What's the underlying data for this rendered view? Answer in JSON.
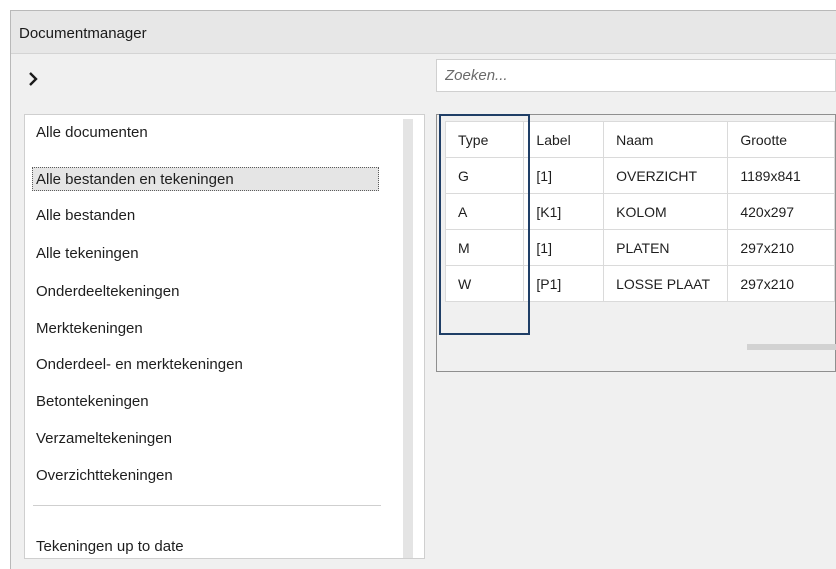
{
  "window": {
    "title": "Documentmanager"
  },
  "search": {
    "placeholder": "Zoeken..."
  },
  "filters": {
    "items": [
      "Alle documenten",
      "Alle bestanden en tekeningen",
      "Alle bestanden",
      "Alle tekeningen",
      "Onderdeeltekeningen",
      "Merktekeningen",
      "Onderdeel- en merktekeningen",
      "Betontekeningen",
      "Verzameltekeningen",
      "Overzichttekeningen"
    ],
    "selected": "Alle bestanden en tekeningen",
    "bottom_item": "Tekeningen up to date"
  },
  "table": {
    "headers": {
      "type": "Type",
      "label": "Label",
      "naam": "Naam",
      "grootte": "Grootte"
    },
    "rows": [
      {
        "type": "G",
        "label": "[1]",
        "naam": "OVERZICHT",
        "grootte": "1189x841"
      },
      {
        "type": "A",
        "label": "[K1]",
        "naam": "KOLOM",
        "grootte": "420x297"
      },
      {
        "type": "M",
        "label": "[1]",
        "naam": "PLATEN",
        "grootte": "297x210"
      },
      {
        "type": "W",
        "label": "[P1]",
        "naam": "LOSSE PLAAT",
        "grootte": "297x210"
      }
    ]
  },
  "colors": {
    "highlight_border": "#1f3e66",
    "selection_background": "#e5e5e5",
    "window_background": "#f0f0f0"
  },
  "icons": {
    "expand": "chevron-right-icon"
  }
}
